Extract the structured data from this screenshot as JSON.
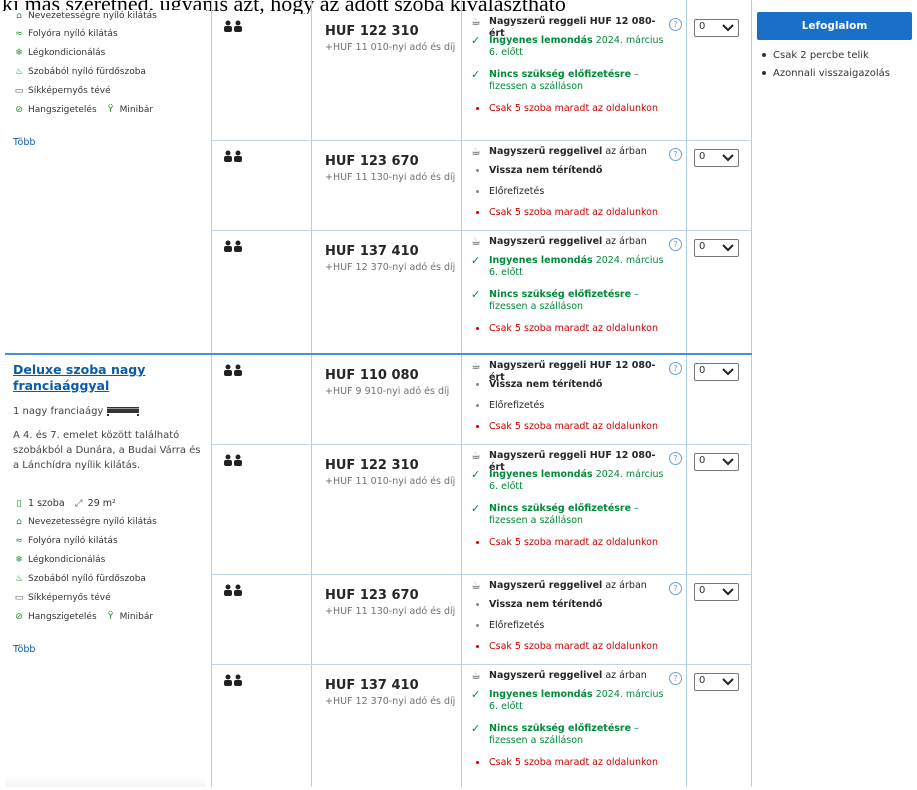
{
  "banner": "ki más szeretnéd, ugyanis azt, hogy az adott szoba kiválasztható",
  "booking": {
    "button_label": "Lefoglalom",
    "info": [
      "Csak 2 percbe telik",
      "Azonnali visszaigazolás"
    ]
  },
  "room_top": {
    "amenities": [
      {
        "icon": "landmark-icon",
        "label": "Nevezetességre nyíló kilátás"
      },
      {
        "icon": "river-view-icon",
        "label": "Folyóra nyíló kilátás"
      },
      {
        "icon": "snowflake-icon",
        "label": "Légkondicionálás"
      },
      {
        "icon": "bath-icon",
        "label": "Szobából nyíló fürdőszoba"
      },
      {
        "icon": "tv-icon",
        "label": "Síkképernyős tévé"
      },
      {
        "icon": "soundproof-icon",
        "label": "Hangszigetelés"
      },
      {
        "icon": "minibar-icon",
        "label": "Minibár"
      }
    ],
    "more": "Több"
  },
  "room_deluxe": {
    "title": "Deluxe szoba nagy franciaággyal",
    "bed": "1 nagy franciaágy",
    "description": "A 4. és 7. emelet között található szobákból a Dunára, a Budai Várra és a Lánchídra nyílik kilátás.",
    "rooms_count": "1 szoba",
    "size": "29 m²",
    "amenities": [
      {
        "icon": "landmark-icon",
        "label": "Nevezetességre nyíló kilátás"
      },
      {
        "icon": "river-view-icon",
        "label": "Folyóra nyíló kilátás"
      },
      {
        "icon": "snowflake-icon",
        "label": "Légkondicionálás"
      },
      {
        "icon": "bath-icon",
        "label": "Szobából nyíló fürdőszoba"
      },
      {
        "icon": "tv-icon",
        "label": "Síkképernyős tévé"
      },
      {
        "icon": "soundproof-icon",
        "label": "Hangszigetelés"
      },
      {
        "icon": "minibar-icon",
        "label": "Minibár"
      }
    ],
    "more": "Több"
  },
  "offers": [
    {
      "price": "HUF 122 310",
      "tax": "+HUF 11 010-nyi adó és díj",
      "meal": "Nagyszerű reggeli HUF 12 080-ért",
      "cancel_bold": "Ingyenes lemondás",
      "cancel_rest": "2024. március 6. előtt",
      "prepay_bold": "Nincs szükség előfizetésre",
      "prepay_rest": "– fizessen a szálláson",
      "scarcity": "Csak 5 szoba maradt az oldalunkon",
      "qty": "0"
    },
    {
      "price": "HUF 123 670",
      "tax": "+HUF 11 130-nyi adó és díj",
      "meal_bold": "Nagyszerű reggelivel",
      "meal_rest": "az árban",
      "nonref": "Vissza nem térítendő",
      "prepay": "Előrefizetés",
      "scarcity": "Csak 5 szoba maradt az oldalunkon",
      "qty": "0"
    },
    {
      "price": "HUF 137 410",
      "tax": "+HUF 12 370-nyi adó és díj",
      "meal_bold": "Nagyszerű reggelivel",
      "meal_rest": "az árban",
      "cancel_bold": "Ingyenes lemondás",
      "cancel_rest": "2024. március 6. előtt",
      "prepay_bold": "Nincs szükség előfizetésre",
      "prepay_rest": "– fizessen a szálláson",
      "scarcity": "Csak 5 szoba maradt az oldalunkon",
      "qty": "0"
    },
    {
      "price": "HUF 110 080",
      "tax": "+HUF 9 910-nyi adó és díj",
      "meal": "Nagyszerű reggeli HUF 12 080-ért",
      "nonref": "Vissza nem térítendő",
      "prepay": "Előrefizetés",
      "scarcity": "Csak 5 szoba maradt az oldalunkon",
      "qty": "0"
    },
    {
      "price": "HUF 122 310",
      "tax": "+HUF 11 010-nyi adó és díj",
      "meal": "Nagyszerű reggeli HUF 12 080-ért",
      "cancel_bold": "Ingyenes lemondás",
      "cancel_rest": "2024. március 6. előtt",
      "prepay_bold": "Nincs szükség előfizetésre",
      "prepay_rest": "– fizessen a szálláson",
      "scarcity": "Csak 5 szoba maradt az oldalunkon",
      "qty": "0"
    },
    {
      "price": "HUF 123 670",
      "tax": "+HUF 11 130-nyi adó és díj",
      "meal_bold": "Nagyszerű reggelivel",
      "meal_rest": "az árban",
      "nonref": "Vissza nem térítendő",
      "prepay": "Előrefizetés",
      "scarcity": "Csak 5 szoba maradt az oldalunkon",
      "qty": "0"
    },
    {
      "price": "HUF 137 410",
      "tax": "+HUF 12 370-nyi adó és díj",
      "meal_bold": "Nagyszerű reggelivel",
      "meal_rest": "az árban",
      "cancel_bold": "Ingyenes lemondás",
      "cancel_rest": "2024. március 6. előtt",
      "prepay_bold": "Nincs szükség előfizetésre",
      "prepay_rest": "– fizessen a szálláson",
      "scarcity": "Csak 5 szoba maradt az oldalunkon",
      "qty": "0"
    }
  ]
}
